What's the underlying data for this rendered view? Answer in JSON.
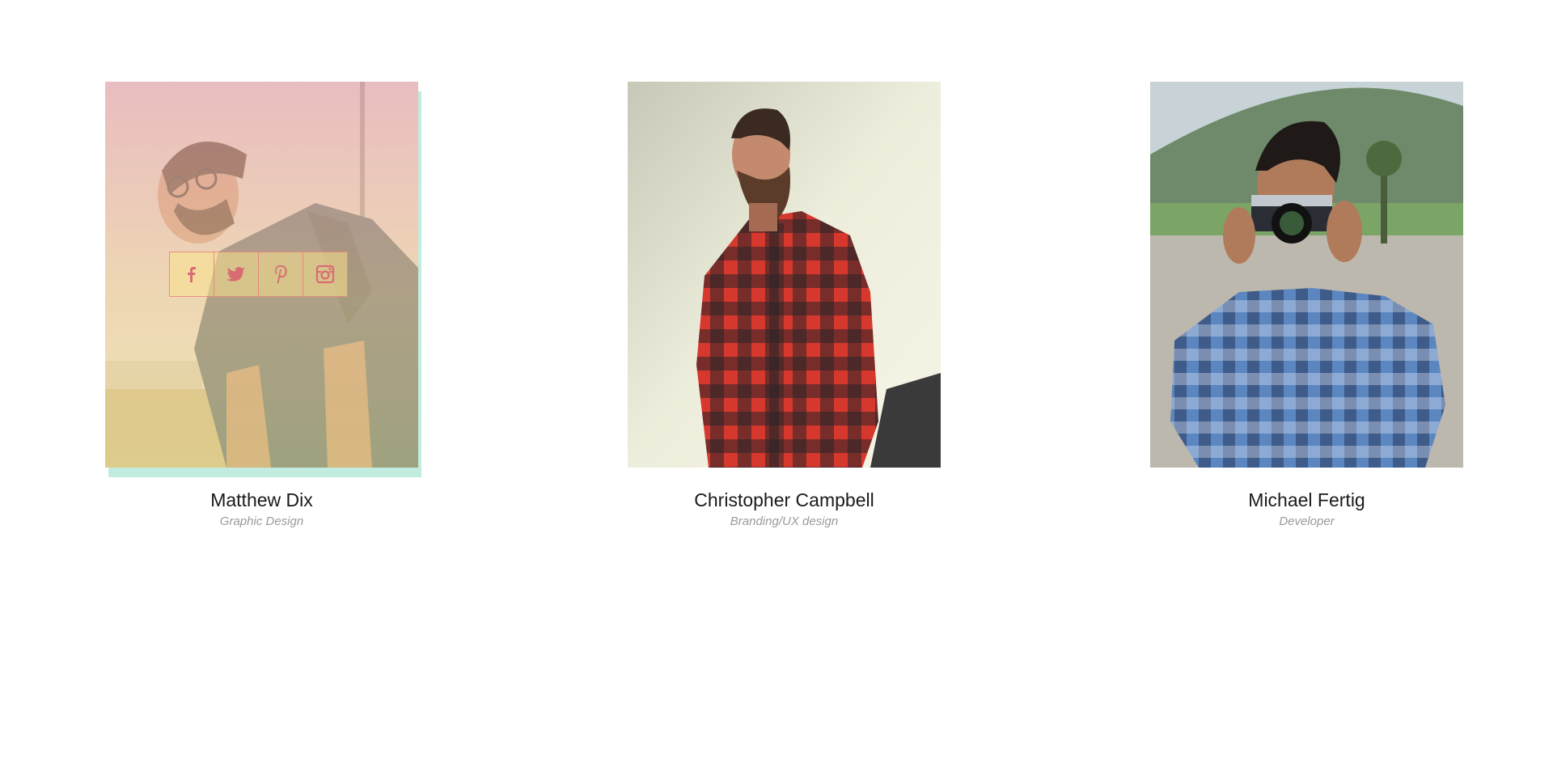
{
  "team": {
    "members": [
      {
        "name": "Matthew Dix",
        "role": "Graphic Design",
        "photo_icon": "portrait-glasses-denim-shirt",
        "hovered": true,
        "social": [
          {
            "icon": "facebook-icon"
          },
          {
            "icon": "twitter-icon"
          },
          {
            "icon": "pinterest-icon"
          },
          {
            "icon": "instagram-icon"
          }
        ]
      },
      {
        "name": "Christopher Campbell",
        "role": "Branding/UX design",
        "photo_icon": "portrait-beard-red-plaid-shirt",
        "hovered": false
      },
      {
        "name": "Michael Fertig",
        "role": "Developer",
        "photo_icon": "portrait-camera-blue-plaid-shirt",
        "hovered": false
      }
    ]
  },
  "colors": {
    "shadow_mint": "#c2ece0",
    "overlay_pink": "#f0aaaf",
    "overlay_yellow": "#eedc8c",
    "social_icon": "#d96b73",
    "name_text": "#1a1a1a",
    "role_text": "#9a9a9a"
  }
}
